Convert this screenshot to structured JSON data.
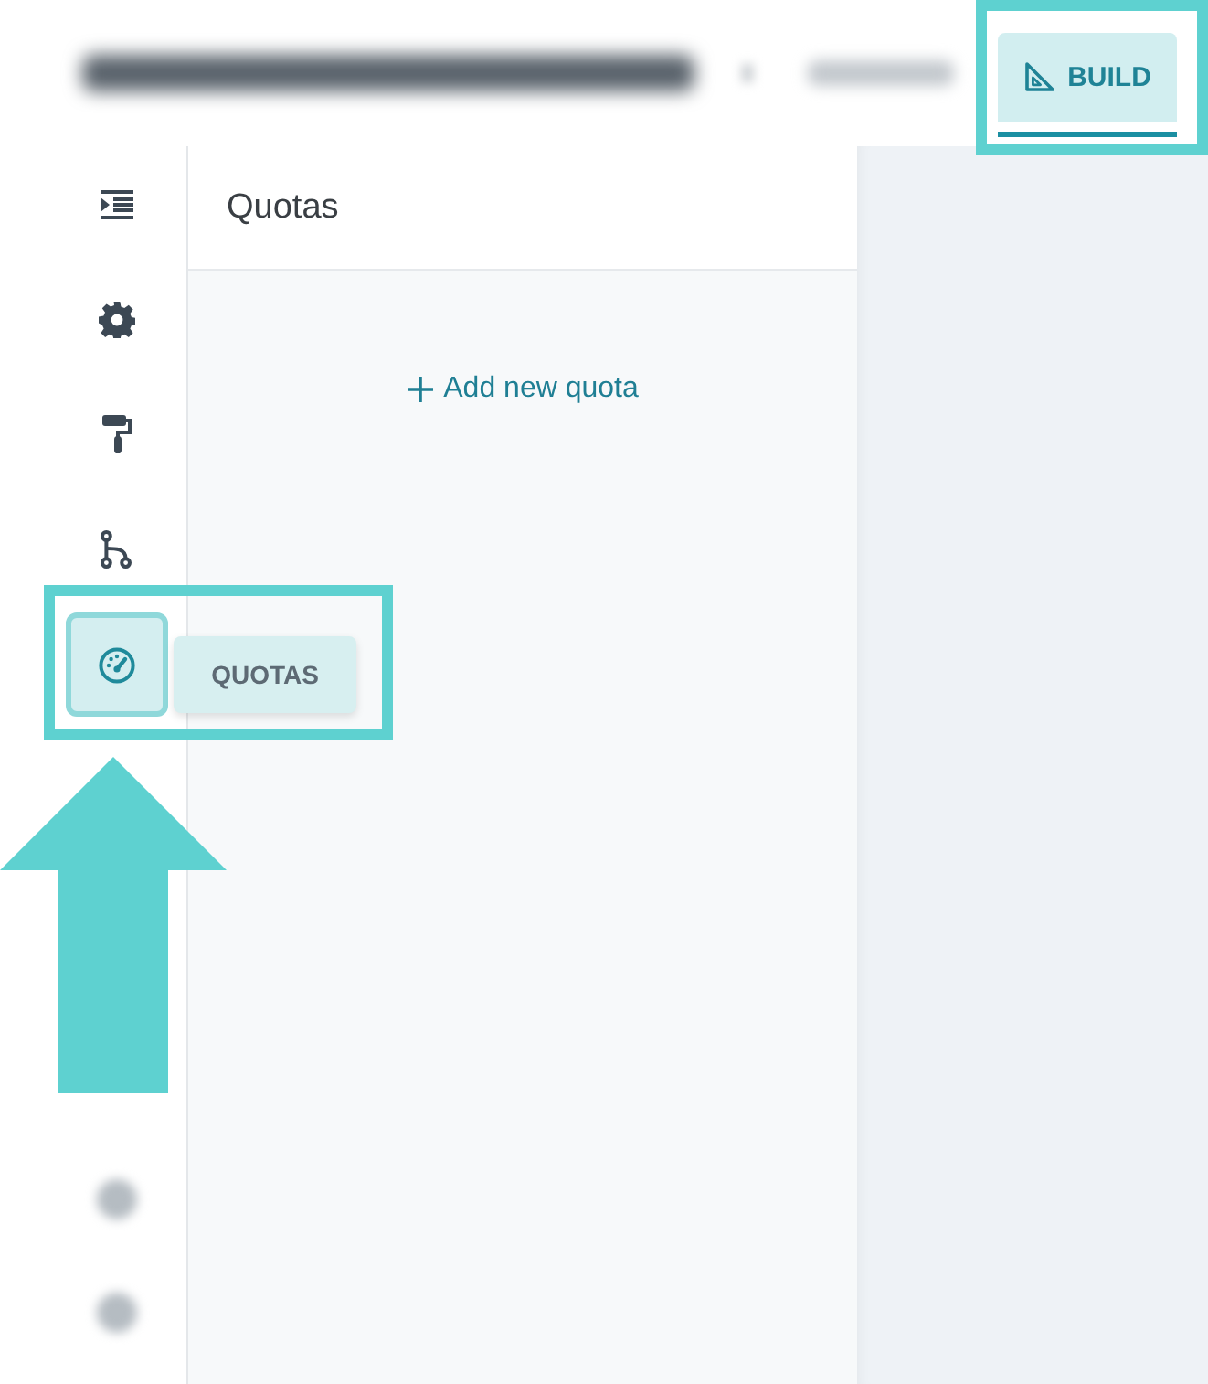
{
  "header": {
    "tabs": [
      {
        "label": "BUILD",
        "selected": true
      }
    ]
  },
  "rail": {
    "items": [
      {
        "kind": "indent",
        "selected": false
      },
      {
        "kind": "gear",
        "selected": false
      },
      {
        "kind": "roller",
        "selected": false
      },
      {
        "kind": "branch",
        "selected": false
      },
      {
        "kind": "gauge",
        "selected": true
      }
    ],
    "tooltip": "QUOTAS"
  },
  "panel": {
    "title": "Quotas",
    "add_link": "Add new quota"
  }
}
